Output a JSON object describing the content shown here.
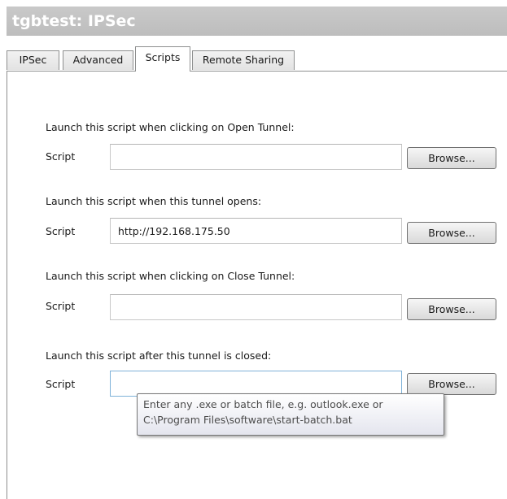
{
  "window": {
    "title": "tgbtest: IPSec"
  },
  "tabs": [
    {
      "label": "IPSec"
    },
    {
      "label": "Advanced"
    },
    {
      "label": "Scripts"
    },
    {
      "label": "Remote Sharing"
    }
  ],
  "active_tab": "Scripts",
  "scripts": [
    {
      "heading": "Launch this script when clicking on Open Tunnel:",
      "label": "Script",
      "value": "",
      "button": "Browse..."
    },
    {
      "heading": "Launch this script when this tunnel opens:",
      "label": "Script",
      "value": "http://192.168.175.50",
      "button": "Browse..."
    },
    {
      "heading": "Launch this script when clicking on Close Tunnel:",
      "label": "Script",
      "value": "",
      "button": "Browse..."
    },
    {
      "heading": "Launch this script after this tunnel is closed:",
      "label": "Script",
      "value": "",
      "button": "Browse..."
    }
  ],
  "tooltip": {
    "line1": "Enter any .exe or batch file, e.g. outlook.exe or",
    "line2": "C:\\Program Files\\software\\start-batch.bat"
  }
}
